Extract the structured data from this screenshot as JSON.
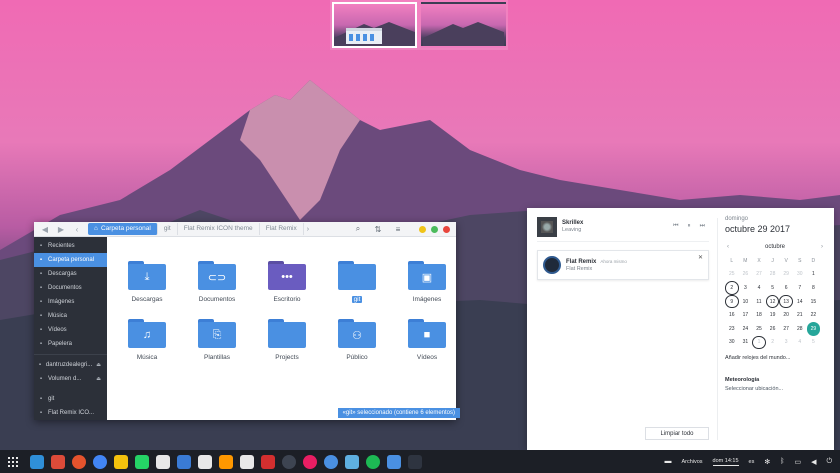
{
  "file_manager": {
    "breadcrumbs": [
      "Carpeta personal",
      "git",
      "Flat Remix ICON theme",
      "Flat Remix"
    ],
    "sidebar": [
      {
        "label": "Recientes",
        "icon": "clock-icon"
      },
      {
        "label": "Carpeta personal",
        "icon": "home-icon",
        "active": true
      },
      {
        "label": "Descargas",
        "icon": "download-icon"
      },
      {
        "label": "Documentos",
        "icon": "document-icon"
      },
      {
        "label": "Imágenes",
        "icon": "image-icon"
      },
      {
        "label": "Música",
        "icon": "music-icon"
      },
      {
        "label": "Vídeos",
        "icon": "video-icon"
      },
      {
        "label": "Papelera",
        "icon": "trash-icon"
      },
      {
        "label": "dantruzdealegri...",
        "icon": "drive-icon"
      },
      {
        "label": "Volumen d...",
        "icon": "drive-icon"
      },
      {
        "label": "git",
        "icon": "folder-icon"
      },
      {
        "label": "Flat Remix ICO...",
        "icon": "folder-icon"
      }
    ],
    "files": [
      {
        "label": "Descargas",
        "glyph": "⤓"
      },
      {
        "label": "Documentos",
        "glyph": "⊂⊃"
      },
      {
        "label": "Escritorio",
        "glyph": "•••"
      },
      {
        "label": "git",
        "glyph": ""
      },
      {
        "label": "Imágenes",
        "glyph": "▣"
      },
      {
        "label": "Música",
        "glyph": "♫"
      },
      {
        "label": "Plantillas",
        "glyph": "⎘"
      },
      {
        "label": "Projects",
        "glyph": ""
      },
      {
        "label": "Público",
        "glyph": "⚇"
      },
      {
        "label": "Vídeos",
        "glyph": "■"
      }
    ],
    "status": "«git» seleccionado (contiene 6 elementos)"
  },
  "panel": {
    "media": {
      "title": "Skrillex",
      "subtitle": "Leaving"
    },
    "notification": {
      "title": "Flat Remix",
      "time": "Ahora mismo",
      "body": "Flat Remix"
    },
    "clear_label": "Limpiar todo",
    "calendar": {
      "weekday": "domingo",
      "date": "octubre 29 2017",
      "month": "octubre",
      "headers": [
        "L",
        "M",
        "X",
        "J",
        "V",
        "S",
        "D"
      ],
      "days": [
        [
          "25",
          "26",
          "27",
          "28",
          "29",
          "30",
          "1"
        ],
        [
          "2",
          "3",
          "4",
          "5",
          "6",
          "7",
          "8"
        ],
        [
          "9",
          "10",
          "11",
          "12",
          "13",
          "14",
          "15"
        ],
        [
          "16",
          "17",
          "18",
          "19",
          "20",
          "21",
          "22"
        ],
        [
          "23",
          "24",
          "25",
          "26",
          "27",
          "28",
          "29"
        ],
        [
          "30",
          "31",
          "1",
          "2",
          "3",
          "4",
          "5"
        ]
      ],
      "world_clocks": "Añadir relojes del mundo...",
      "weather_title": "Meteorología",
      "weather_action": "Seleccionar ubicación..."
    }
  },
  "dock": {
    "files_label": "Archivos",
    "clock": "dom 14:15",
    "language": "es",
    "app_colors": [
      "#2f8fd8",
      "#dd4b39",
      "#e5532d",
      "#4285f4",
      "#f4c20d",
      "#25d366",
      "#e8e8e8",
      "#3a7bd5",
      "#e8e8e8",
      "#ff9800",
      "#e8e8e8",
      "#d32f2f",
      "#3d4451",
      "#e91e63",
      "#4a90e2",
      "#5fb0e0",
      "#1db954",
      "#4a90e2",
      "#2e3440"
    ]
  }
}
